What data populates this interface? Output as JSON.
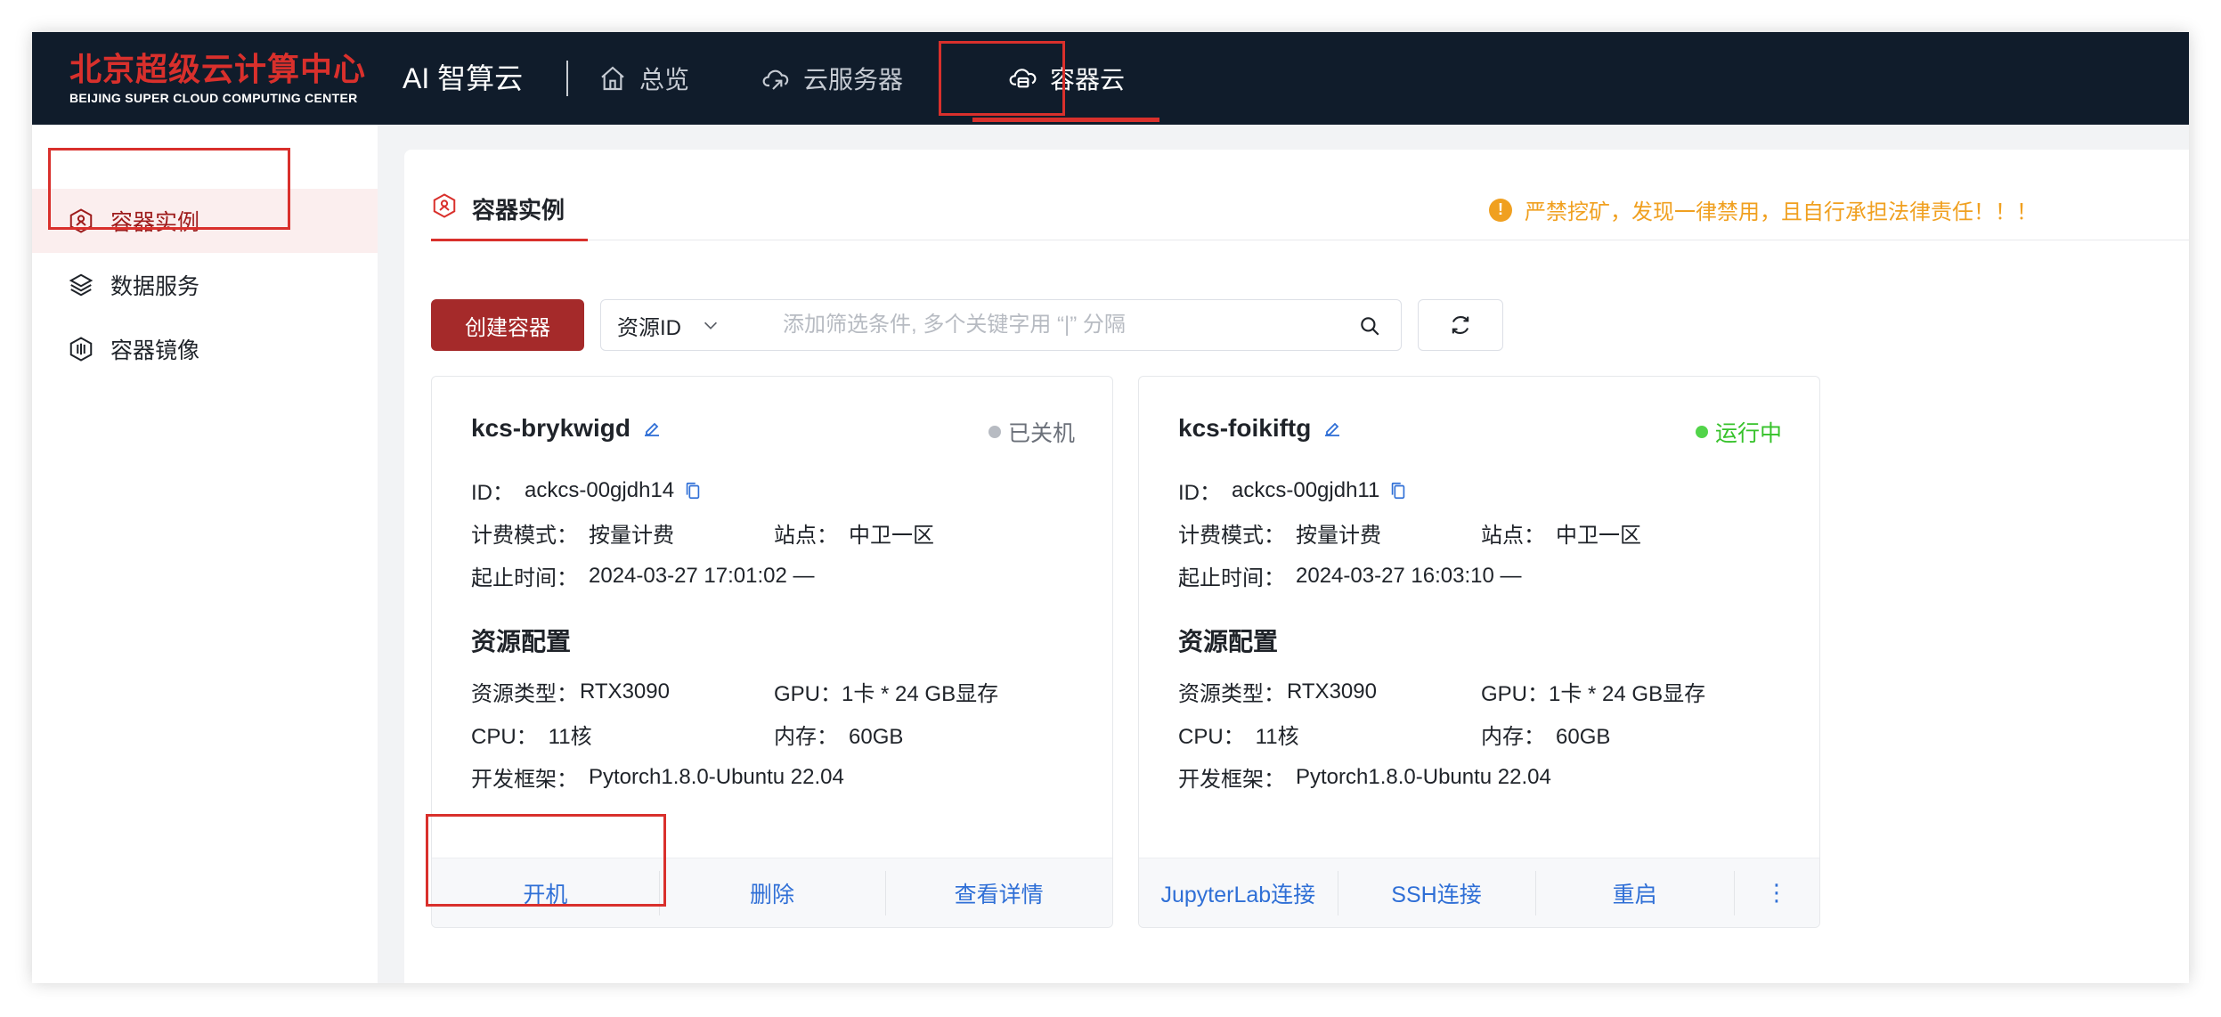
{
  "brand": {
    "cn": "北京超级云计算中心",
    "en": "BEIJING SUPER CLOUD COMPUTING CENTER",
    "color": "#d9302c"
  },
  "product": "AI 智算云",
  "nav": {
    "items": [
      {
        "label": "总览",
        "icon": "home-icon"
      },
      {
        "label": "云服务器",
        "icon": "cloud-server-icon"
      },
      {
        "label": "容器云",
        "icon": "container-cloud-icon",
        "active": true
      }
    ]
  },
  "sidebar": {
    "items": [
      {
        "label": "容器实例",
        "icon": "container-instance-icon",
        "active": true
      },
      {
        "label": "数据服务",
        "icon": "layers-icon"
      },
      {
        "label": "容器镜像",
        "icon": "image-icon"
      }
    ]
  },
  "tab": {
    "label": "容器实例"
  },
  "warning": {
    "text": "严禁挖矿，发现一律禁用，且自行承担法律责任！！！",
    "icon_text": "!"
  },
  "toolbar": {
    "create_label": "创建容器",
    "filter_select": "资源ID",
    "search_placeholder": "添加筛选条件, 多个关键字用 “|” 分隔"
  },
  "labels": {
    "id": "ID：",
    "billing": "计费模式：",
    "site": "站点：",
    "period": "起止时间：",
    "resource_section": "资源配置",
    "resource_type": "资源类型：",
    "gpu": "GPU：",
    "cpu": "CPU：",
    "memory": "内存：",
    "framework": "开发框架："
  },
  "cards": [
    {
      "name": "kcs-brykwigd",
      "status": "已关机",
      "id": "ackcs-00gjdh14",
      "billing": "按量计费",
      "site": "中卫一区",
      "period": "2024-03-27 17:01:02 —",
      "resource_type": "RTX3090",
      "gpu": "1卡 * 24 GB显存",
      "cpu": "11核",
      "memory": "60GB",
      "framework": "Pytorch1.8.0-Ubuntu 22.04",
      "actions": [
        "开机",
        "删除",
        "查看详情"
      ]
    },
    {
      "name": "kcs-foikiftg",
      "status": "运行中",
      "id": "ackcs-00gjdh11",
      "billing": "按量计费",
      "site": "中卫一区",
      "period": "2024-03-27 16:03:10 —",
      "resource_type": "RTX3090",
      "gpu": "1卡 * 24 GB显存",
      "cpu": "11核",
      "memory": "60GB",
      "framework": "Pytorch1.8.0-Ubuntu 22.04",
      "actions": [
        "JupyterLab连接",
        "SSH连接",
        "重启",
        "⋮"
      ]
    }
  ],
  "colors": {
    "accent": "#d9302c",
    "primary_button": "#a52a2a",
    "link": "#2f6fd6",
    "running": "#36c22a",
    "warning": "#f0a020",
    "topbar": "#101c2b"
  }
}
